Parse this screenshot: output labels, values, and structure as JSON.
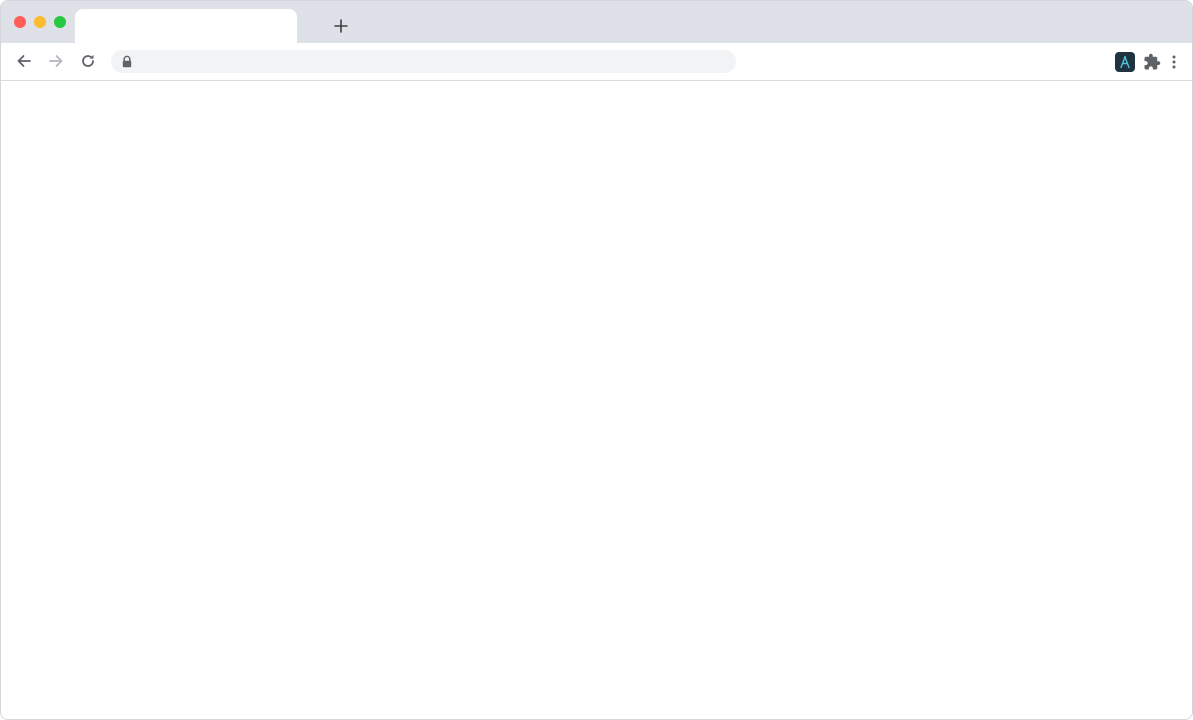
{
  "window": {
    "traffic_lights": {
      "close_color": "#ff5f57",
      "minimize_color": "#febc2e",
      "maximize_color": "#28c840"
    }
  },
  "tabs": [
    {
      "title": "",
      "active": true
    }
  ],
  "toolbar": {
    "url": "",
    "url_placeholder": "",
    "icons": {
      "back": "arrow-left-icon",
      "forward": "arrow-right-icon",
      "reload": "reload-icon",
      "lock": "lock-icon",
      "new_tab": "plus-icon",
      "extension_app": "letter-a-app-icon",
      "extensions": "puzzle-piece-icon",
      "menu": "vertical-dots-icon"
    }
  },
  "colors": {
    "tabstrip_bg": "#dee1e8",
    "omnibox_bg": "#f1f3f4",
    "icon_active": "#5f6368",
    "icon_disabled": "#b4b7bb",
    "extension_app_bg": "#1f3440",
    "extension_app_accent": "#4fc3d9"
  }
}
